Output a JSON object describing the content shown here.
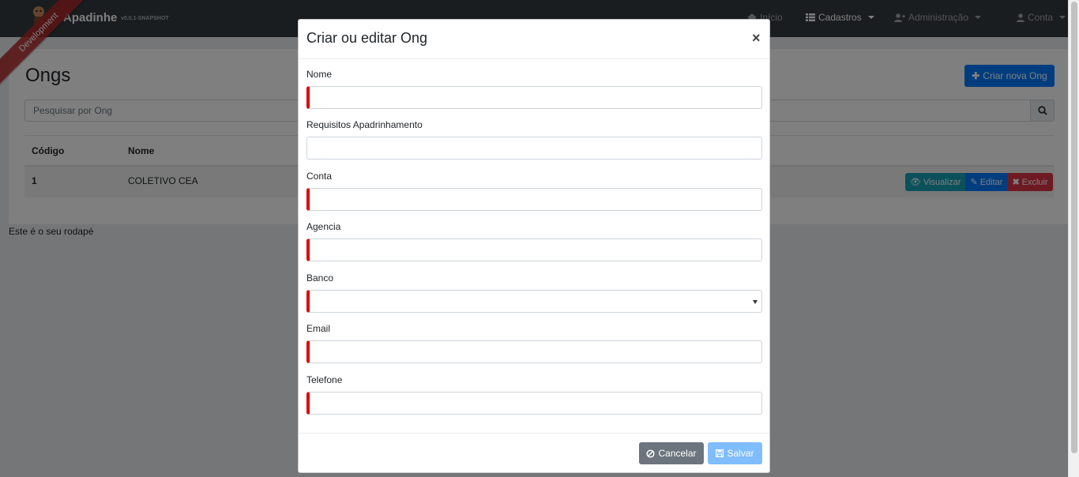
{
  "navbar": {
    "brand": "Apadinhe",
    "version": "v0.0.1-SNAPSHOT",
    "ribbon": "Development",
    "items": [
      {
        "label": "Início",
        "icon": "home-icon"
      },
      {
        "label": "Cadastros",
        "icon": "list-icon"
      },
      {
        "label": "Administração",
        "icon": "user-plus-icon"
      },
      {
        "label": "Conta",
        "icon": "user-icon"
      }
    ]
  },
  "page": {
    "title": "Ongs",
    "create_button": "Criar nova Ong",
    "search_placeholder": "Pesquisar por Ong",
    "table": {
      "headers": [
        "Código",
        "Nome"
      ],
      "rows": [
        {
          "codigo": "1",
          "nome": "COLETIVO CEA"
        }
      ],
      "actions": {
        "view": "Visualizar",
        "edit": "Editar",
        "delete": "Excluir"
      }
    },
    "footer": "Este é o seu rodapé"
  },
  "modal": {
    "title": "Criar ou editar Ong",
    "close": "×",
    "fields": [
      {
        "label": "Nome",
        "value": ""
      },
      {
        "label": "Requisitos Apadrinhamento",
        "value": ""
      },
      {
        "label": "Conta",
        "value": ""
      },
      {
        "label": "Agencia",
        "value": ""
      },
      {
        "label": "Banco",
        "value": ""
      },
      {
        "label": "Email",
        "value": ""
      },
      {
        "label": "Telefone",
        "value": ""
      }
    ],
    "cancel": "Cancelar",
    "save": "Salvar"
  },
  "colors": {
    "navbar": "#343a40",
    "primary": "#007bff",
    "info": "#17a2b8",
    "danger": "#dc3545",
    "secondary": "#6c757d",
    "required_marker": "#e00000"
  }
}
